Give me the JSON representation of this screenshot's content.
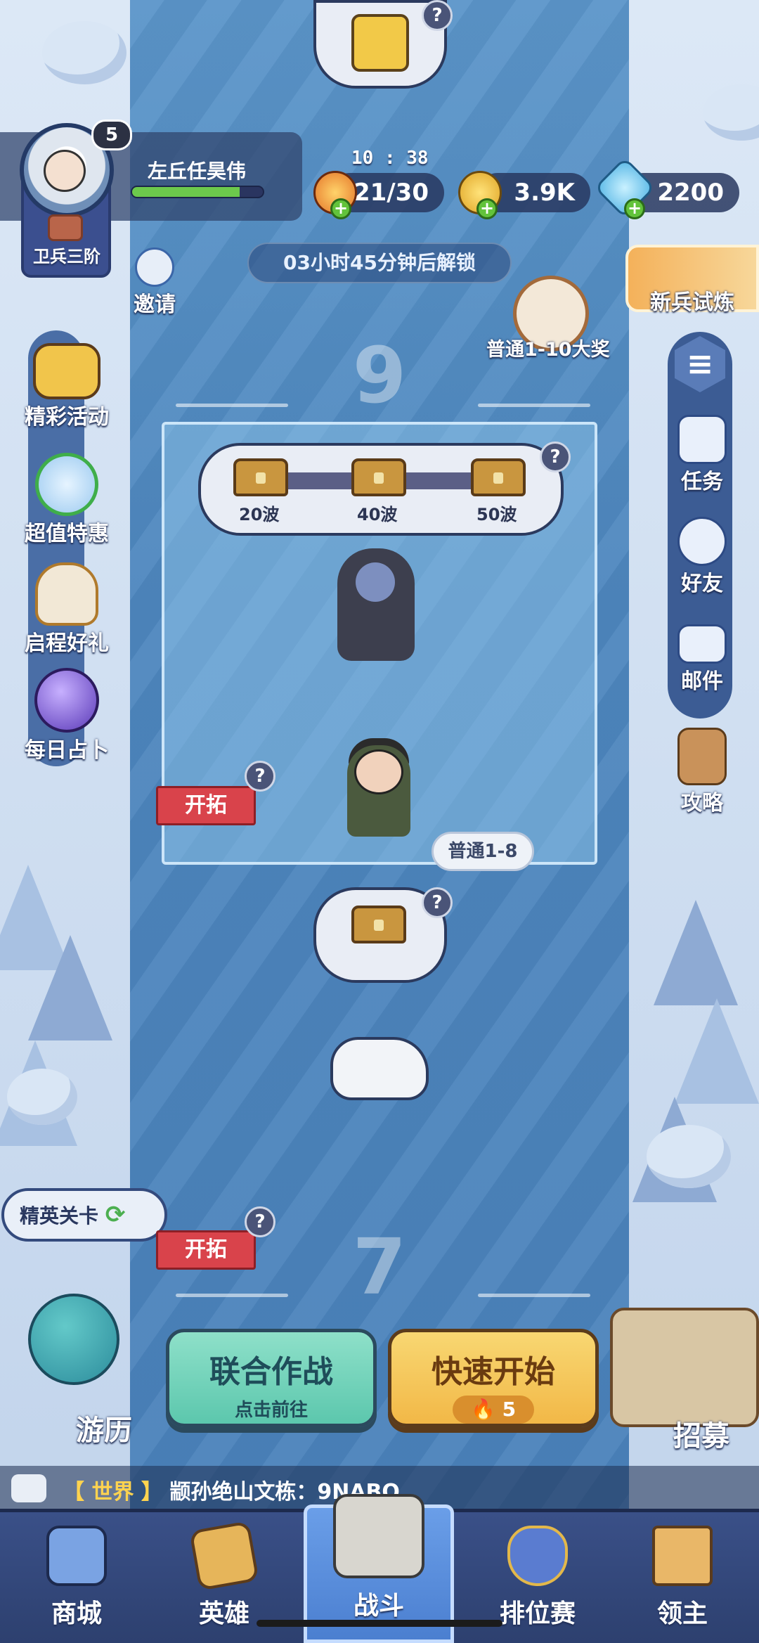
{
  "player": {
    "name": "左丘任昊伟",
    "level": "5",
    "rank": "卫兵三阶",
    "xp_progress": 0.82
  },
  "hud": {
    "timer": "10 : 38",
    "stamina": "21/30",
    "gold": "3.9K",
    "gems": "2200",
    "unlock_text": "03小时45分钟后解锁",
    "invite_label": "邀请"
  },
  "left_menu": [
    {
      "label": "精彩活动",
      "icon": "chest-event-icon"
    },
    {
      "label": "超值特惠",
      "icon": "clock-deal-icon"
    },
    {
      "label": "启程好礼",
      "icon": "bird-gift-icon"
    },
    {
      "label": "每日占卜",
      "icon": "crystal-ball-icon"
    }
  ],
  "right_menu": {
    "trial_label": "新兵试炼",
    "boss_reward_label": "普通1-10大奖",
    "items": [
      {
        "label": "任务",
        "icon": "quest-scroll-icon"
      },
      {
        "label": "好友",
        "icon": "friends-icon"
      },
      {
        "label": "邮件",
        "icon": "mail-icon"
      },
      {
        "label": "攻略",
        "icon": "guide-book-icon"
      }
    ]
  },
  "stage_upper": {
    "number": "9",
    "wave_rewards": [
      "20波",
      "40波",
      "50波"
    ],
    "explore_label": "开拓",
    "normal_tag": "普通1-8",
    "help": "?"
  },
  "stage_lower": {
    "number": "7",
    "explore_label": "开拓",
    "help": "?"
  },
  "elite_label": "精英关卡",
  "travel_label": "游历",
  "recruit_label": "招募",
  "buttons": {
    "coop_title": "联合作战",
    "coop_sub": "点击前往",
    "quick_title": "快速开始",
    "quick_cost": "5"
  },
  "chat": {
    "channel": "【 世界 】",
    "message": "颛孙绝山文栋：9NABO"
  },
  "tabs": [
    {
      "label": "商城",
      "icon": "shop-icon"
    },
    {
      "label": "英雄",
      "icon": "hero-card-icon"
    },
    {
      "label": "战斗",
      "icon": "battle-swords-icon"
    },
    {
      "label": "排位赛",
      "icon": "ranked-shield-icon"
    },
    {
      "label": "领主",
      "icon": "lord-banner-icon"
    }
  ],
  "colors": {
    "accent_green": "#5cc7ad",
    "accent_orange": "#f2b847",
    "explore_red": "#d9434b",
    "river": "#4d86be"
  }
}
